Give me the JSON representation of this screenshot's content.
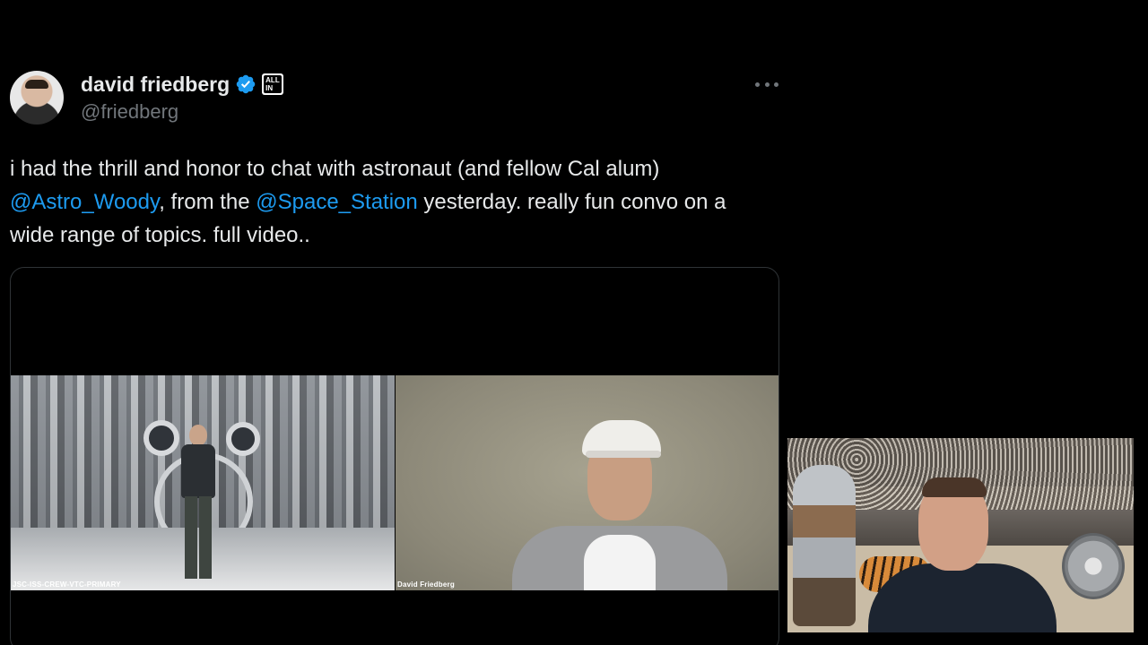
{
  "tweet": {
    "author": {
      "display_name": "david friedberg",
      "handle": "@friedberg",
      "verified": true,
      "affiliation_badge": "ALL IN",
      "avatar_icon": "avatar-photo"
    },
    "more_icon": "more-horizontal-icon",
    "text_segments": {
      "line1": "i had the thrill and honor to chat with astronaut (and fellow Cal alum)",
      "mention1": "@Astro_Woody",
      "mid": ", from the ",
      "mention2": "@Space_Station",
      "line2_tail": " yesterday. really fun convo on a",
      "line3": "wide range of topics. full video.."
    }
  },
  "media": {
    "left_pane_label": "JSC-ISS-CREW-VTC-PRIMARY",
    "right_pane_label": "David Friedberg"
  },
  "colors": {
    "background": "#000000",
    "text": "#e7e9ea",
    "secondary_text": "#71767b",
    "link": "#1d9bf0",
    "verified_badge": "#1d9bf0"
  }
}
